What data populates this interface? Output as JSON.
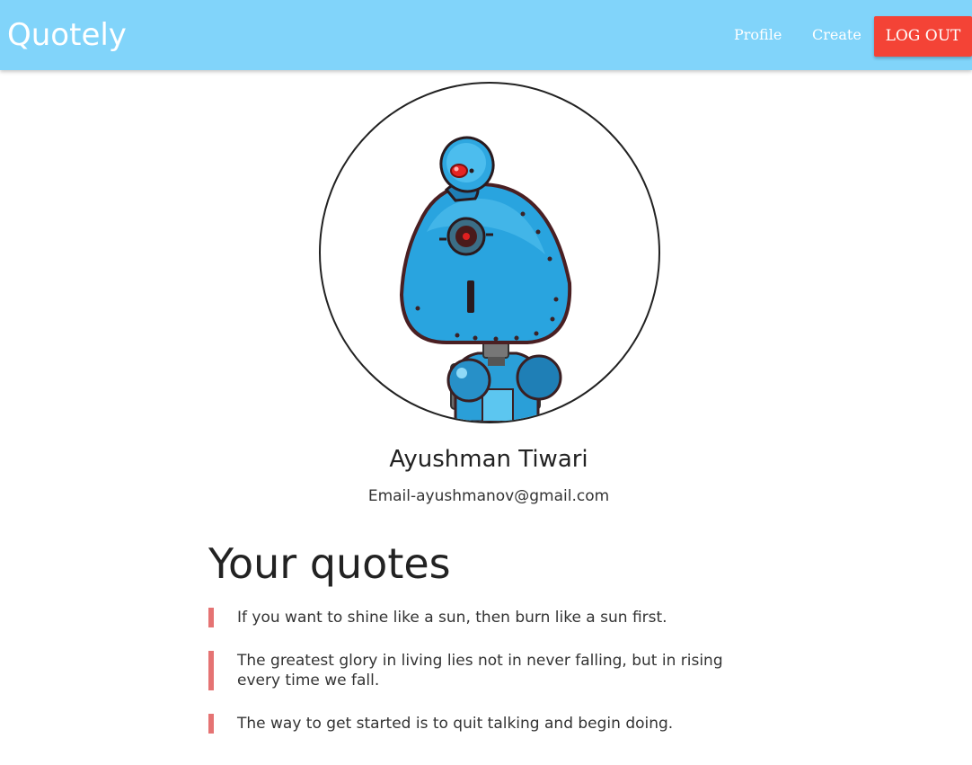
{
  "navbar": {
    "brand": "Quotely",
    "links": {
      "profile": "Profile",
      "create": "Create"
    },
    "logout_label": "LOG OUT",
    "colors": {
      "bar": "#81d4fa",
      "logout": "#f44336"
    }
  },
  "profile": {
    "avatar_icon": "robot-avatar-icon",
    "name": "Ayushman Tiwari",
    "email": "Email-ayushmanov@gmail.com"
  },
  "quotes": {
    "heading": "Your quotes",
    "accent_color": "#e57373",
    "items": [
      "If you want to shine like a sun, then burn like a sun first.",
      "The greatest glory in living lies not in never falling, but in rising every time we fall.",
      "The way to get started is to quit talking and begin doing."
    ]
  }
}
